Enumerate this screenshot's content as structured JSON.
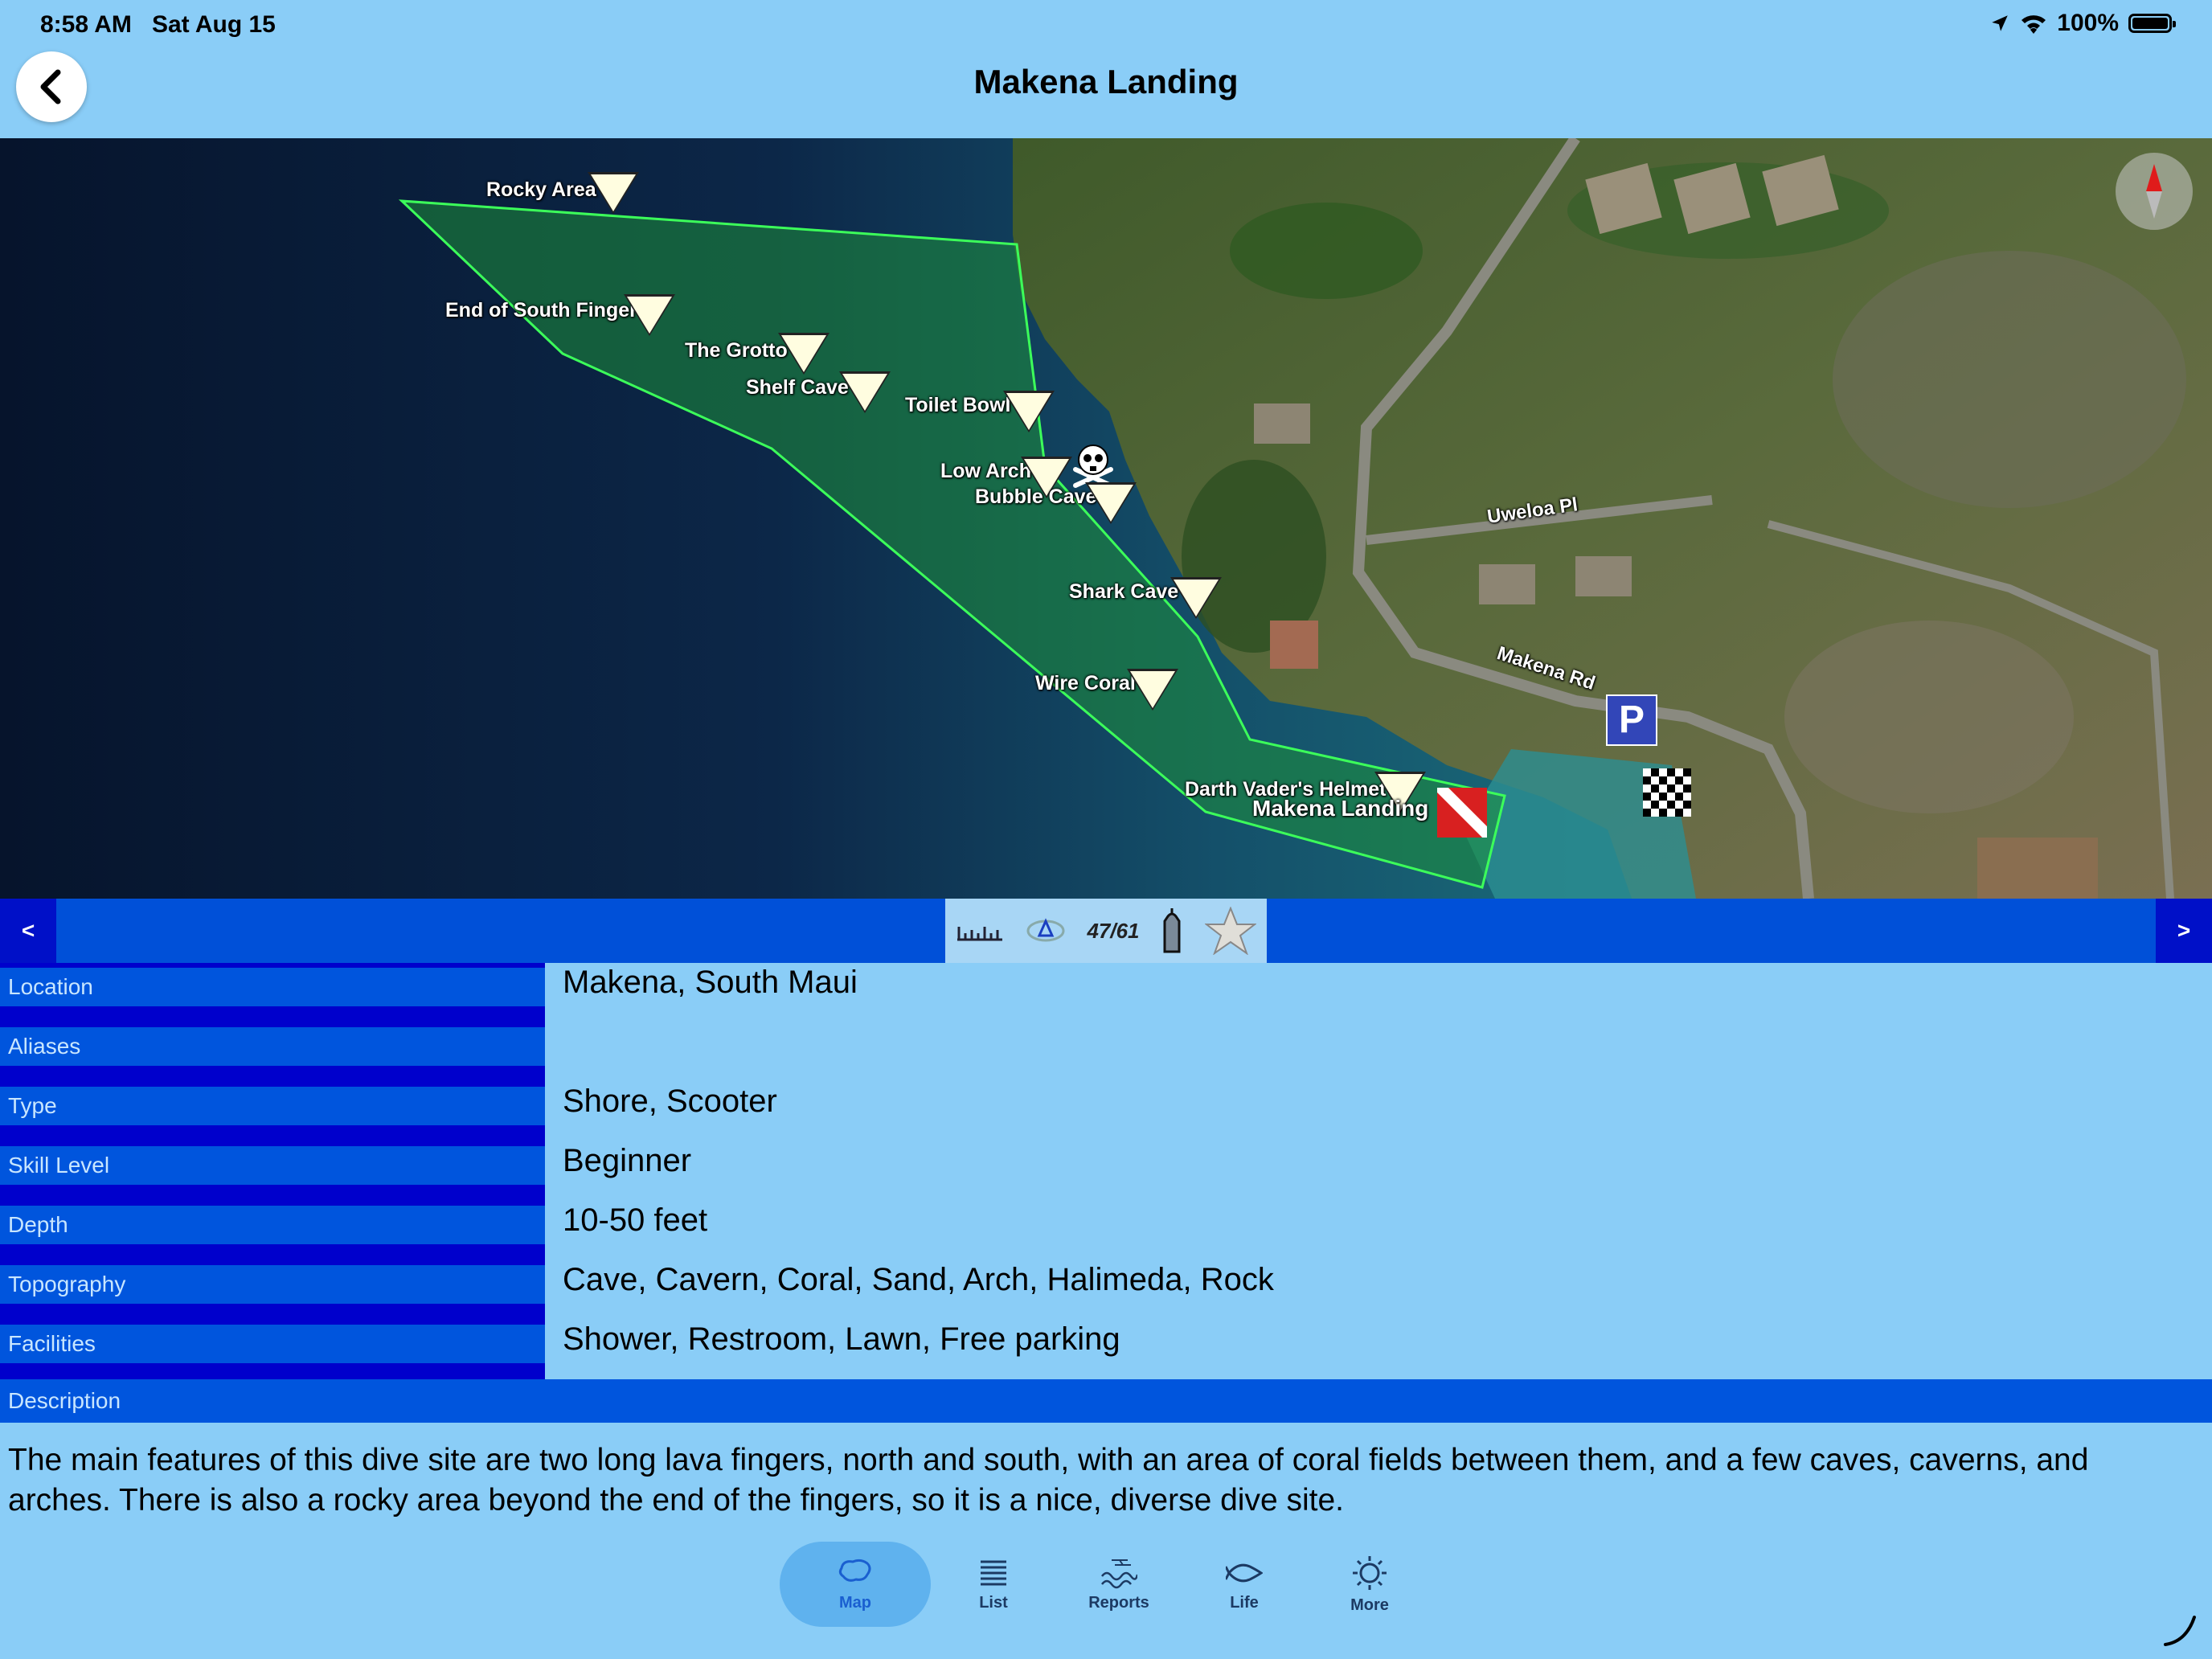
{
  "status": {
    "time": "8:58 AM",
    "date": "Sat Aug 15",
    "battery": "100%"
  },
  "nav": {
    "title": "Makena Landing",
    "back_icon": "chevron-left-icon"
  },
  "map": {
    "sites": [
      {
        "name": "Rocky Area"
      },
      {
        "name": "End of South Finger"
      },
      {
        "name": "The Grotto"
      },
      {
        "name": "Shelf Cave"
      },
      {
        "name": "Toilet Bowl"
      },
      {
        "name": "Low Arch"
      },
      {
        "name": "Bubble Cave"
      },
      {
        "name": "Shark Cave"
      },
      {
        "name": "Wire Coral"
      },
      {
        "name": "Darth Vader's Helmet"
      }
    ],
    "entry_label": "Makena Landing",
    "roads": {
      "uweloa": "Uweloa Pl",
      "makena": "Makena Rd"
    },
    "parking_letter": "P",
    "zone_color": "#1e8f3a"
  },
  "pager": {
    "prev": "<",
    "next": ">",
    "count": "47/61"
  },
  "details": [
    {
      "label": "Location",
      "value": "Makena, South Maui"
    },
    {
      "label": "Aliases",
      "value": ""
    },
    {
      "label": "Type",
      "value": "Shore,  Scooter"
    },
    {
      "label": "Skill Level",
      "value": "Beginner"
    },
    {
      "label": "Depth",
      "value": "10-50 feet"
    },
    {
      "label": "Topography",
      "value": "Cave,  Cavern,  Coral,  Sand,  Arch,  Halimeda,  Rock"
    },
    {
      "label": "Facilities",
      "value": "Shower,  Restroom,  Lawn,  Free parking"
    }
  ],
  "description": {
    "label": "Description",
    "text": "The main features of this dive site are two long lava fingers, north and south, with an area of coral fields between them, and a few caves, caverns, and arches. There is also a rocky area beyond the end of the fingers, so it is a nice, diverse dive site."
  },
  "tabs": [
    {
      "label": "Map",
      "icon": "map-icon",
      "active": true
    },
    {
      "label": "List",
      "icon": "list-icon",
      "active": false
    },
    {
      "label": "Reports",
      "icon": "waves-icon",
      "active": false
    },
    {
      "label": "Life",
      "icon": "fish-icon",
      "active": false
    },
    {
      "label": "More",
      "icon": "sun-icon",
      "active": false
    }
  ]
}
